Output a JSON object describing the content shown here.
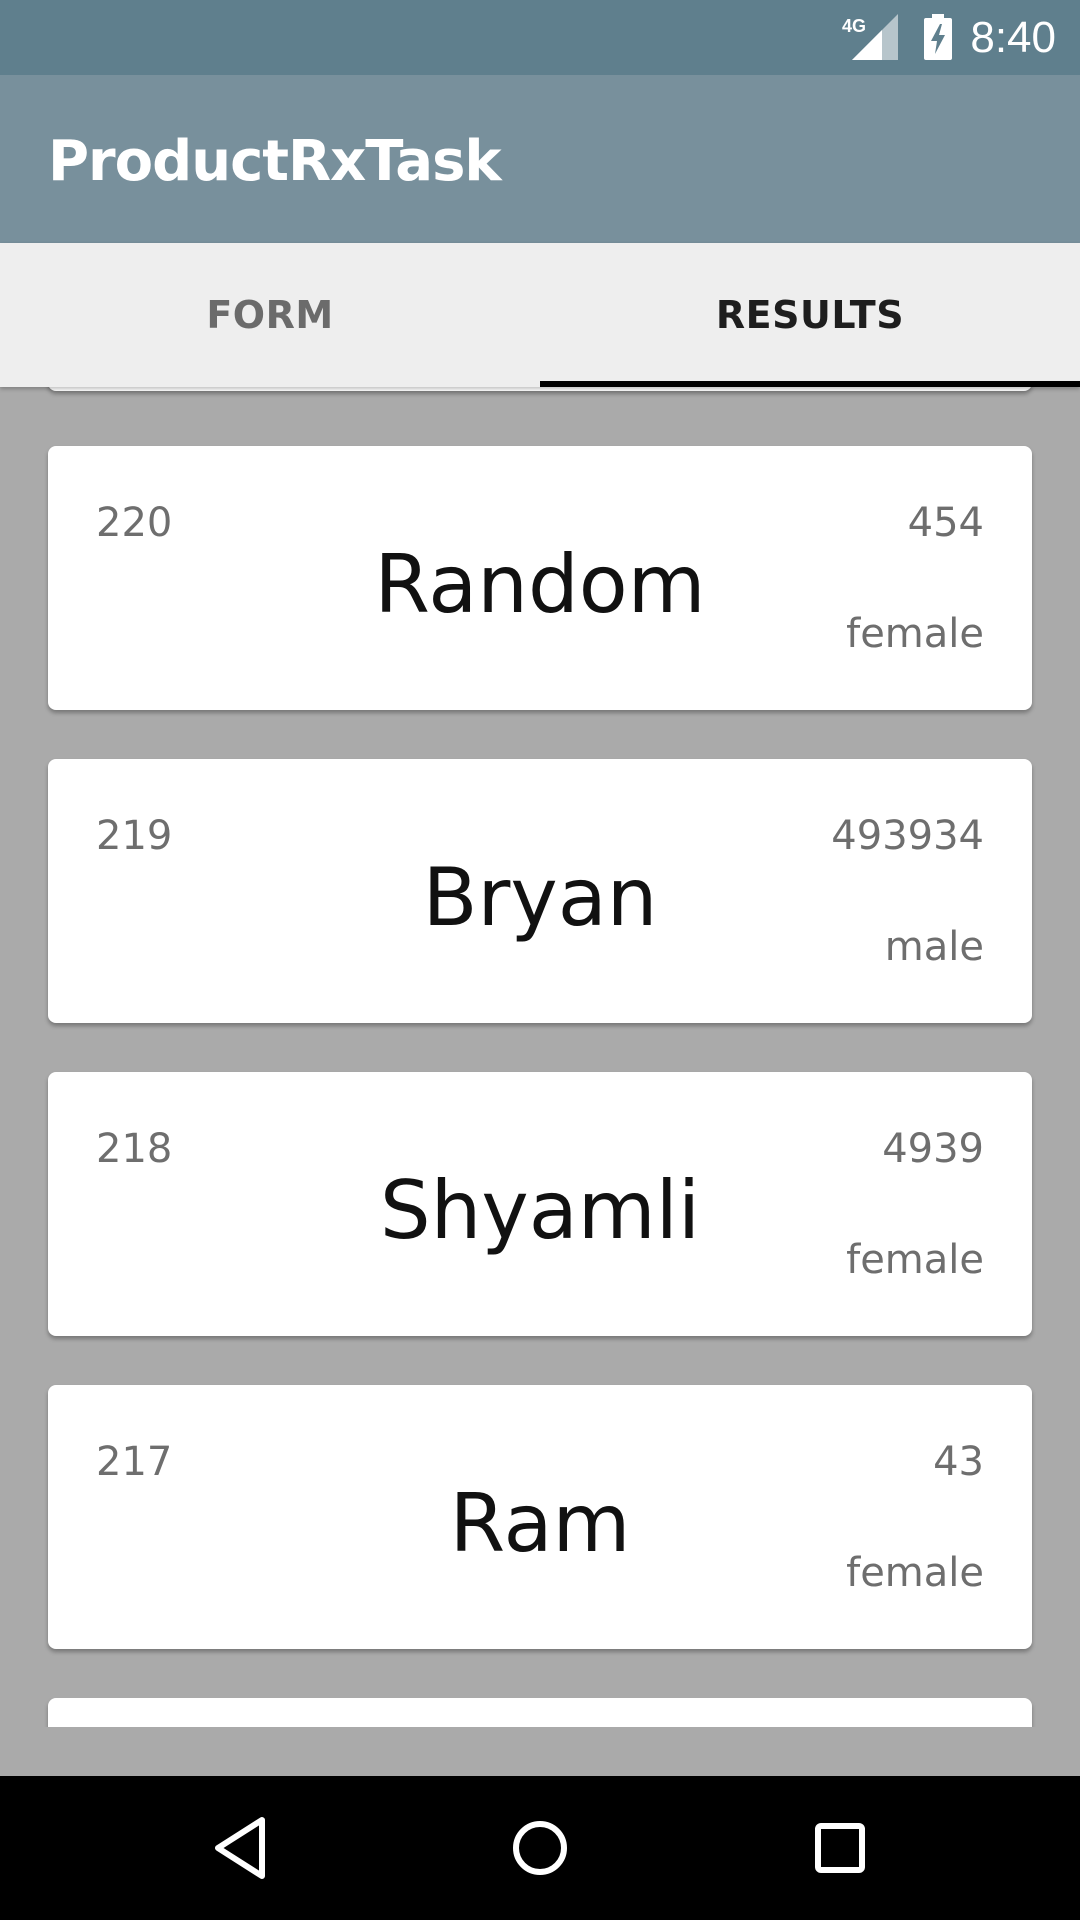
{
  "status_bar": {
    "network": "4G",
    "time": "8:40",
    "signal_icon": "cell-signal-icon",
    "battery_icon": "battery-charging-icon"
  },
  "app_bar": {
    "title": "ProductRxTask"
  },
  "tabs": [
    {
      "label": "FORM",
      "selected": false
    },
    {
      "label": "RESULTS",
      "selected": true
    }
  ],
  "results": [
    {
      "id": "220",
      "name": "Random",
      "number": "454",
      "gender": "female"
    },
    {
      "id": "219",
      "name": "Bryan",
      "number": "493934",
      "gender": "male"
    },
    {
      "id": "218",
      "name": "Shyamli",
      "number": "4939",
      "gender": "female"
    },
    {
      "id": "217",
      "name": "Ram",
      "number": "43",
      "gender": "female"
    }
  ],
  "nav_bar": {
    "back_icon": "back-triangle-icon",
    "home_icon": "home-circle-icon",
    "recents_icon": "recents-square-icon"
  },
  "colors": {
    "status_bar": "#5f7f8d",
    "app_bar": "#78909c",
    "tab_bar": "#eeeeee",
    "list_background": "#aaaaaa",
    "card": "#ffffff",
    "tab_indicator": "#000000"
  }
}
